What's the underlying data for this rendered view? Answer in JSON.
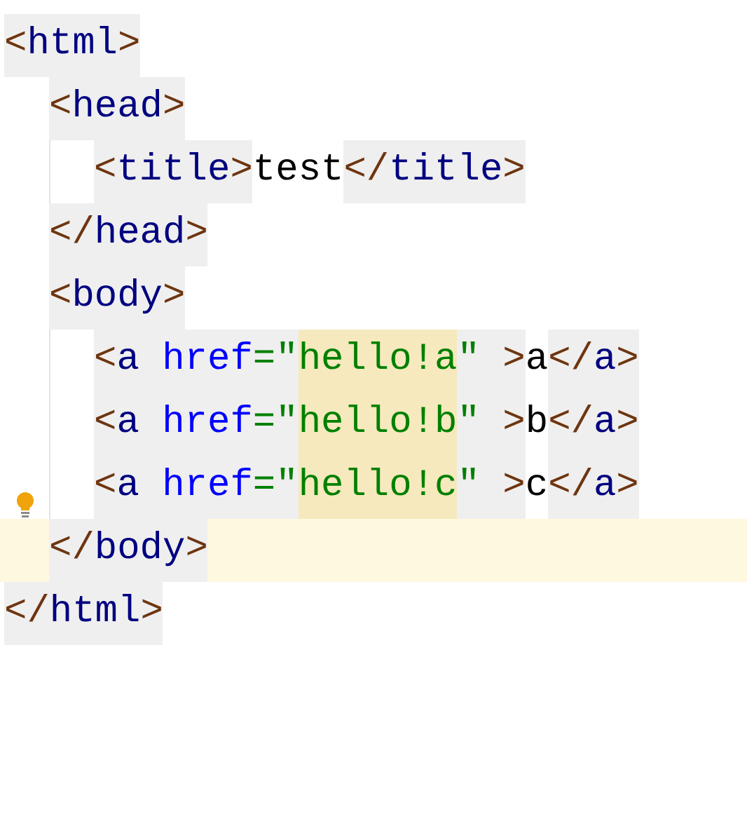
{
  "lines": [
    {
      "current": false,
      "segments": [
        {
          "kind": "tag",
          "tokens": [
            {
              "kind": "punct",
              "text": "<"
            },
            {
              "kind": "name",
              "text": "html"
            },
            {
              "kind": "punct",
              "text": ">"
            }
          ]
        }
      ],
      "children": [
        {
          "current": false,
          "segments": [
            {
              "kind": "tag",
              "tokens": [
                {
                  "kind": "punct",
                  "text": "<"
                },
                {
                  "kind": "name",
                  "text": "head"
                },
                {
                  "kind": "punct",
                  "text": ">"
                }
              ]
            }
          ],
          "children": [
            {
              "current": false,
              "segments": [
                {
                  "kind": "tag",
                  "tokens": [
                    {
                      "kind": "punct",
                      "text": "<"
                    },
                    {
                      "kind": "name",
                      "text": "title"
                    },
                    {
                      "kind": "punct",
                      "text": ">"
                    }
                  ]
                },
                {
                  "kind": "text",
                  "text": "test"
                },
                {
                  "kind": "tag",
                  "tokens": [
                    {
                      "kind": "punct",
                      "text": "</"
                    },
                    {
                      "kind": "name",
                      "text": "title"
                    },
                    {
                      "kind": "punct",
                      "text": ">"
                    }
                  ]
                }
              ]
            }
          ]
        },
        {
          "current": false,
          "segments": [
            {
              "kind": "tag",
              "tokens": [
                {
                  "kind": "punct",
                  "text": "</"
                },
                {
                  "kind": "name",
                  "text": "head"
                },
                {
                  "kind": "punct",
                  "text": ">"
                }
              ]
            }
          ]
        },
        {
          "current": false,
          "segments": [
            {
              "kind": "tag",
              "tokens": [
                {
                  "kind": "punct",
                  "text": "<"
                },
                {
                  "kind": "name",
                  "text": "body"
                },
                {
                  "kind": "punct",
                  "text": ">"
                }
              ]
            }
          ],
          "children": [
            {
              "current": false,
              "segments": [
                {
                  "kind": "tag",
                  "tokens": [
                    {
                      "kind": "punct",
                      "text": "<"
                    },
                    {
                      "kind": "name",
                      "text": "a "
                    },
                    {
                      "kind": "attr",
                      "text": "href"
                    },
                    {
                      "kind": "string",
                      "text": "=\""
                    },
                    {
                      "kind": "match",
                      "text": "hello!a"
                    },
                    {
                      "kind": "string",
                      "text": "\" "
                    },
                    {
                      "kind": "punct",
                      "text": ">"
                    }
                  ]
                },
                {
                  "kind": "text",
                  "text": "a"
                },
                {
                  "kind": "tag",
                  "tokens": [
                    {
                      "kind": "punct",
                      "text": "</"
                    },
                    {
                      "kind": "name",
                      "text": "a"
                    },
                    {
                      "kind": "punct",
                      "text": ">"
                    }
                  ]
                }
              ]
            },
            {
              "current": false,
              "segments": [
                {
                  "kind": "tag",
                  "tokens": [
                    {
                      "kind": "punct",
                      "text": "<"
                    },
                    {
                      "kind": "name",
                      "text": "a "
                    },
                    {
                      "kind": "attr",
                      "text": "href"
                    },
                    {
                      "kind": "string",
                      "text": "=\""
                    },
                    {
                      "kind": "match",
                      "text": "hello!b"
                    },
                    {
                      "kind": "string",
                      "text": "\" "
                    },
                    {
                      "kind": "punct",
                      "text": ">"
                    }
                  ]
                },
                {
                  "kind": "text",
                  "text": "b"
                },
                {
                  "kind": "tag",
                  "tokens": [
                    {
                      "kind": "punct",
                      "text": "</"
                    },
                    {
                      "kind": "name",
                      "text": "a"
                    },
                    {
                      "kind": "punct",
                      "text": ">"
                    }
                  ]
                }
              ]
            },
            {
              "current": false,
              "segments": [
                {
                  "kind": "tag",
                  "tokens": [
                    {
                      "kind": "punct",
                      "text": "<"
                    },
                    {
                      "kind": "name",
                      "text": "a "
                    },
                    {
                      "kind": "attr",
                      "text": "href"
                    },
                    {
                      "kind": "string",
                      "text": "=\""
                    },
                    {
                      "kind": "match",
                      "text": "hello!c"
                    },
                    {
                      "kind": "string",
                      "text": "\" "
                    },
                    {
                      "kind": "punct",
                      "text": ">"
                    }
                  ]
                },
                {
                  "kind": "text",
                  "text": "c"
                },
                {
                  "kind": "tag",
                  "tokens": [
                    {
                      "kind": "punct",
                      "text": "</"
                    },
                    {
                      "kind": "name",
                      "text": "a"
                    },
                    {
                      "kind": "punct",
                      "text": ">"
                    }
                  ]
                }
              ]
            }
          ]
        },
        {
          "current": true,
          "segments": [
            {
              "kind": "tag",
              "tokens": [
                {
                  "kind": "punct",
                  "text": "</"
                },
                {
                  "kind": "name",
                  "text": "body"
                },
                {
                  "kind": "punct",
                  "text": ">"
                }
              ]
            }
          ]
        }
      ]
    },
    {
      "current": false,
      "segments": [
        {
          "kind": "tag",
          "tokens": [
            {
              "kind": "punct",
              "text": "</"
            },
            {
              "kind": "name",
              "text": "html"
            },
            {
              "kind": "punct",
              "text": ">"
            }
          ]
        }
      ]
    }
  ]
}
